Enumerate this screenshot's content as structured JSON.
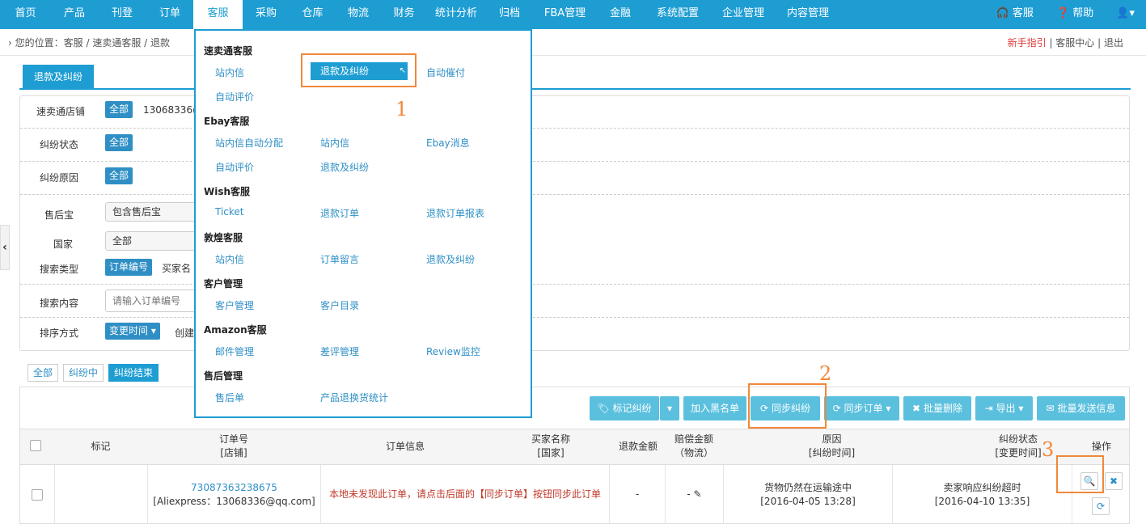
{
  "nav": {
    "items": [
      "首页",
      "产品",
      "刊登",
      "订单",
      "客服",
      "采购",
      "仓库",
      "物流",
      "财务",
      "统计分析",
      "归档",
      "FBA管理",
      "金融",
      "系统配置",
      "企业管理",
      "内容管理"
    ],
    "right": [
      "客服",
      "帮助",
      ""
    ]
  },
  "breadcrumb": {
    "prefix": "您的位置：",
    "items": [
      "客服",
      "速卖通客服",
      "退款"
    ],
    "links": [
      "新手指引",
      "客服中心",
      "退出"
    ]
  },
  "tab_active": "退款及纠纷",
  "filter": {
    "shop_label": "速卖通店铺",
    "shop_all": "全部",
    "shop_value": "13068336@",
    "status_label": "纠纷状态",
    "status_all": "全部",
    "reason_label": "纠纷原因",
    "reason_all": "全部",
    "aftersale_label": "售后宝",
    "aftersale_value": "包含售后宝",
    "country_label": "国家",
    "country_value": "全部",
    "searchtype_label": "搜索类型",
    "searchtype_value": "订单编号",
    "searchtype_other": "买家名",
    "content_label": "搜索内容",
    "content_placeholder": "请输入订单编号",
    "sort_label": "排序方式",
    "sort_value": "变更时间",
    "sort_other": "创建"
  },
  "subtabs": [
    "全部",
    "纠纷中",
    "纠纷结束"
  ],
  "actions": {
    "mark": "标记纠纷",
    "blacklist": "加入黑名单",
    "sync_dispute": "同步纠纷",
    "sync_order": "同步订单",
    "batch_delete": "批量删除",
    "export": "导出",
    "batch_send": "批量发送信息"
  },
  "table": {
    "headers": {
      "mark": "标记",
      "order": "订单号",
      "shop": "[店铺]",
      "info": "订单信息",
      "buyer": "买家名称",
      "country": "[国家]",
      "refund": "退款金额",
      "comp": "赔偿金额",
      "logistics": "（物流）",
      "reason": "原因",
      "dtime": "[纠纷时间]",
      "status": "纠纷状态",
      "ctime": "[变更时间]",
      "op": "操作"
    },
    "row": {
      "order_no": "73087363238675",
      "shop": "[Aliexpress：13068336@qq.com]",
      "info": "本地未发现此订单，请点击后面的【同步订单】按钮同步此订单",
      "refund": "-",
      "comp": "-",
      "reason": "货物仍然在运输途中",
      "dispute_time": "[2016-04-05 13:28]",
      "status": "卖家响应纠纷超时",
      "change_time": "[2016-04-10 13:35]"
    }
  },
  "dropdown": {
    "groups": [
      {
        "title": "速卖通客服",
        "items": [
          "站内信",
          "退款及纠纷",
          "自动催付",
          "自动评价"
        ]
      },
      {
        "title": "Ebay客服",
        "items": [
          "站内信自动分配",
          "站内信",
          "Ebay消息",
          "自动评价",
          "退款及纠纷"
        ]
      },
      {
        "title": "Wish客服",
        "items": [
          "Ticket",
          "退款订单",
          "退款订单报表"
        ]
      },
      {
        "title": "敦煌客服",
        "items": [
          "站内信",
          "订单留言",
          "退款及纠纷"
        ]
      },
      {
        "title": "客户管理",
        "items": [
          "客户管理",
          "客户目录"
        ]
      },
      {
        "title": "Amazon客服",
        "items": [
          "邮件管理",
          "差评管理",
          "Review监控"
        ]
      },
      {
        "title": "售后管理",
        "items": [
          "售后单",
          "产品退换货统计"
        ]
      }
    ]
  },
  "annotations": [
    "1",
    "2",
    "3"
  ],
  "colors": {
    "primary": "#1e9dd3",
    "button": "#5bc0de",
    "highlight": "#f0883a",
    "warning_text": "#c0392b"
  }
}
